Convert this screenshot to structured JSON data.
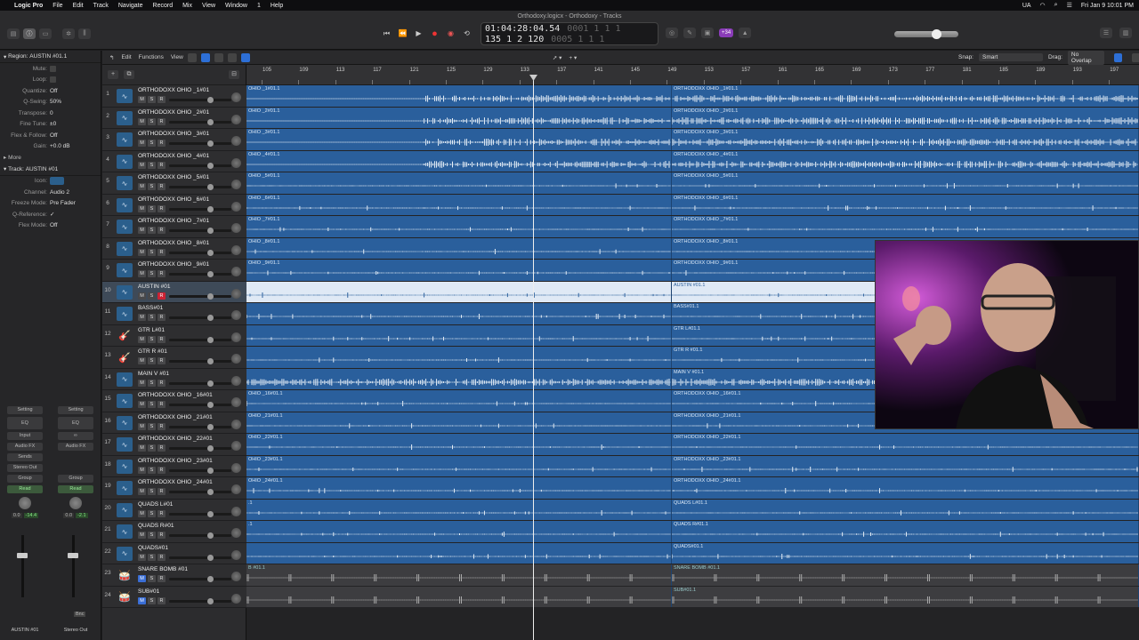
{
  "menubar": {
    "items": [
      "Logic Pro",
      "File",
      "Edit",
      "Track",
      "Navigate",
      "Record",
      "Mix",
      "View",
      "Window",
      "1",
      "Help"
    ],
    "status_lang": "UA",
    "datetime": "Fri Jan 9  10:01 PM"
  },
  "window": {
    "title": "Orthodoxy.logicx - Orthodoxy - Tracks"
  },
  "lcd": {
    "time": "01:04:28:04.54",
    "time_sub": "0001 1 1 1",
    "bars": "135  1  2  120",
    "bars_sub": "0005 1 1 1"
  },
  "control": {
    "badge": "+34"
  },
  "inspector": {
    "region_header": "Region:",
    "region_name": "AUSTIN #01.1",
    "region_rows": [
      {
        "label": "Mute:",
        "value": ""
      },
      {
        "label": "Loop:",
        "value": ""
      },
      {
        "label": "Quantize:",
        "value": "Off"
      },
      {
        "label": "Q-Swing:",
        "value": "50%"
      },
      {
        "label": "Transpose:",
        "value": "0"
      },
      {
        "label": "Fine Tune:",
        "value": "±0"
      },
      {
        "label": "Flex & Follow:",
        "value": "Off"
      },
      {
        "label": "Gain:",
        "value": "+0.0 dB"
      }
    ],
    "more_label": "More",
    "track_header": "Track:",
    "track_name": "AUSTIN #01",
    "track_rows": [
      {
        "label": "Icon:",
        "value": ""
      },
      {
        "label": "Channel:",
        "value": "Audio 2"
      },
      {
        "label": "Freeze Mode:",
        "value": "Pre Fader"
      },
      {
        "label": "Q-Reference:",
        "value": "✓"
      },
      {
        "label": "Flex Mode:",
        "value": "Off"
      }
    ],
    "strip_left": {
      "setting": "Setting",
      "eq": "EQ",
      "input": "Input",
      "audio_fx": "Audio FX",
      "sends": "Sends",
      "output": "Stereo Out",
      "group": "Group",
      "read": "Read",
      "vol": "0.0",
      "peak": "-14.4",
      "name": "AUSTIN #01"
    },
    "strip_right": {
      "setting": "Setting",
      "eq": "EQ",
      "audio_fx": "Audio FX",
      "group": "Group",
      "read": "Read",
      "vol": "0.0",
      "peak": "-2.1",
      "bnc": "Bnc",
      "name": "Stereo Out"
    }
  },
  "toolbar": {
    "edit": "Edit",
    "functions": "Functions",
    "view": "View",
    "snap_label": "Snap:",
    "snap_value": "Smart",
    "drag_label": "Drag:",
    "drag_value": "No Overlap"
  },
  "ruler": {
    "bars": [
      "105",
      "109",
      "113",
      "117",
      "121",
      "125",
      "129",
      "133",
      "137",
      "141",
      "145",
      "149",
      "153",
      "157",
      "161",
      "165",
      "169",
      "173",
      "177",
      "181",
      "185",
      "189",
      "193",
      "197"
    ]
  },
  "tracks": [
    {
      "num": "1",
      "name": "ORTHODOXX OHIO _1#01",
      "region_a": "OHIO _1#01.1",
      "region_b": "ORTHODOXX OHIO _1#01.1",
      "type": "audio"
    },
    {
      "num": "2",
      "name": "ORTHODOXX OHIO _2#01",
      "region_a": "OHIO _2#01.1",
      "region_b": "ORTHODOXX OHIO _2#01.1",
      "type": "audio"
    },
    {
      "num": "3",
      "name": "ORTHODOXX OHIO _3#01",
      "region_a": "OHIO _3#01.1",
      "region_b": "ORTHODOXX OHIO _3#01.1",
      "type": "audio"
    },
    {
      "num": "4",
      "name": "ORTHODOXX OHIO _4#01",
      "region_a": "OHIO _4#01.1",
      "region_b": "ORTHODOXX OHIO _4#01.1",
      "type": "audio"
    },
    {
      "num": "5",
      "name": "ORTHODOXX OHIO _5#01",
      "region_a": "OHIO _5#01.1",
      "region_b": "ORTHODOXX OHIO _5#01.1",
      "type": "audio"
    },
    {
      "num": "6",
      "name": "ORTHODOXX OHIO _6#01",
      "region_a": "OHIO _6#01.1",
      "region_b": "ORTHODOXX OHIO _6#01.1",
      "type": "audio"
    },
    {
      "num": "7",
      "name": "ORTHODOXX OHIO _7#01",
      "region_a": "OHIO _7#01.1",
      "region_b": "ORTHODOXX OHIO _7#01.1",
      "type": "audio"
    },
    {
      "num": "8",
      "name": "ORTHODOXX OHIO _8#01",
      "region_a": "OHIO _8#01.1",
      "region_b": "ORTHODOXX OHIO _8#01.1",
      "type": "audio"
    },
    {
      "num": "9",
      "name": "ORTHODOXX OHIO _9#01",
      "region_a": "OHIO _9#01.1",
      "region_b": "ORTHODOXX OHIO _9#01.1",
      "type": "audio"
    },
    {
      "num": "10",
      "name": "AUSTIN #01",
      "region_a": "",
      "region_b": "AUSTIN #01.1",
      "type": "audio",
      "selected": true
    },
    {
      "num": "11",
      "name": "BASS#01",
      "region_a": "",
      "region_b": "BASS#01.1",
      "type": "audio"
    },
    {
      "num": "12",
      "name": "GTR L#01",
      "region_a": "",
      "region_b": "GTR L#01.1",
      "type": "guitar"
    },
    {
      "num": "13",
      "name": "GTR R #01",
      "region_a": "",
      "region_b": "GTR R #01.1",
      "type": "guitar"
    },
    {
      "num": "14",
      "name": "MAIN V #01",
      "region_a": "",
      "region_b": "MAIN V #01.1",
      "type": "audio"
    },
    {
      "num": "15",
      "name": "ORTHODOXX OHIO _16#01",
      "region_a": "OHIO _16#01.1",
      "region_b": "ORTHODOXX OHIO _16#01.1",
      "type": "audio"
    },
    {
      "num": "16",
      "name": "ORTHODOXX OHIO _21#01",
      "region_a": "OHIO _21#01.1",
      "region_b": "ORTHODOXX OHIO _21#01.1",
      "type": "audio"
    },
    {
      "num": "17",
      "name": "ORTHODOXX OHIO _22#01",
      "region_a": "OHIO _22#01.1",
      "region_b": "ORTHODOXX OHIO _22#01.1",
      "type": "audio"
    },
    {
      "num": "18",
      "name": "ORTHODOXX OHIO _23#01",
      "region_a": "OHIO _23#01.1",
      "region_b": "ORTHODOXX OHIO _23#01.1",
      "type": "audio"
    },
    {
      "num": "19",
      "name": "ORTHODOXX OHIO _24#01",
      "region_a": "OHIO _24#01.1",
      "region_b": "ORTHODOXX OHIO _24#01.1",
      "type": "audio"
    },
    {
      "num": "20",
      "name": "QUADS L#01",
      "region_a": ".1",
      "region_b": "QUADS L#01.1",
      "type": "audio"
    },
    {
      "num": "21",
      "name": "QUADS R#01",
      "region_a": ".1",
      "region_b": "QUADS R#01.1",
      "type": "audio"
    },
    {
      "num": "22",
      "name": "QUADS#01",
      "region_a": "",
      "region_b": "QUADS#01.1",
      "type": "audio"
    },
    {
      "num": "23",
      "name": "SNARE BOMB #01",
      "region_a": "B #01.1",
      "region_b": "SNARE BOMB #01.1",
      "type": "drum"
    },
    {
      "num": "24",
      "name": "SUB#01",
      "region_a": "",
      "region_b": "SUB#01.1",
      "type": "drum"
    }
  ],
  "msr": {
    "m": "M",
    "s": "S",
    "r": "R"
  },
  "colors": {
    "region": "#2a5f9c",
    "selected_region": "#dfe9f5",
    "record": "#e33",
    "accent": "#2d6fd6"
  }
}
